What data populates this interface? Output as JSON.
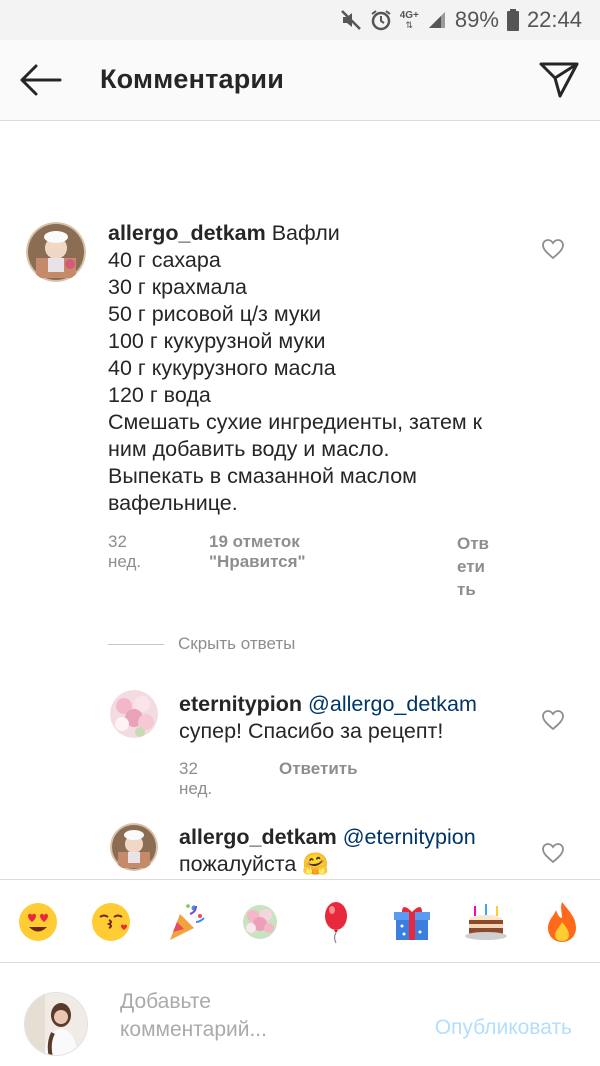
{
  "status_bar": {
    "network": "4G+",
    "battery": "89%",
    "time": "22:44",
    "icons": [
      "mute-icon",
      "alarm-icon",
      "network-icon",
      "signal-icon",
      "battery-icon"
    ]
  },
  "header": {
    "title": "Комментарии",
    "back_icon": "arrow-left-icon",
    "send_icon": "paper-plane-icon"
  },
  "main_comment": {
    "username": "allergo_detkam",
    "lines": [
      "Вафли",
      "40 г сахара",
      "30 г крахмала",
      "50 г рисовой ц/з муки",
      "100 г кукурузной муки",
      "40 г кукурузного масла",
      "120 г вода",
      "Смешать сухие ингредиенты, затем к",
      "ним добавить воду и масло.",
      "Выпекать в смазанной маслом",
      "вафельнице."
    ],
    "time": "32 нед.",
    "likes": "19 отметок \"Нравится\"",
    "reply_lines": [
      "Отв",
      "ети",
      "ть"
    ]
  },
  "hide_replies": "Скрыть ответы",
  "replies": [
    {
      "username": "eternitypion",
      "mention": "@allergo_detkam",
      "text": "супер! Спасибо за рецепт!",
      "time": "32 нед.",
      "reply": "Ответить"
    },
    {
      "username": "allergo_detkam",
      "mention": "@eternitypion",
      "text": "пожалуйста 🤗"
    }
  ],
  "emoji_bar": [
    "😍",
    "😚",
    "🎉",
    "💐",
    "🎈",
    "🎁",
    "🎂",
    "🔥"
  ],
  "comment_input": {
    "placeholder_lines": [
      "Добавьте",
      "комментарий..."
    ],
    "publish": "Опубликовать"
  },
  "colors": {
    "text": "#262626",
    "meta": "#8e8e8e",
    "mention": "#003569",
    "publish_disabled": "#b2dffc"
  }
}
